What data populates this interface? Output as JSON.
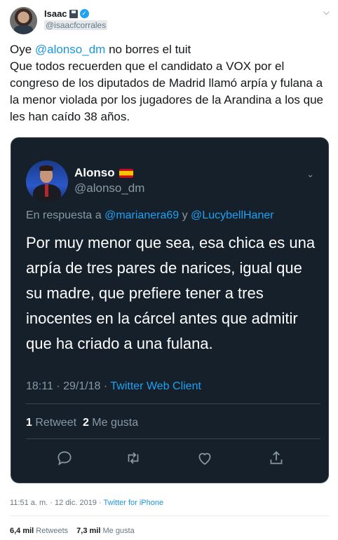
{
  "author": {
    "name": "Isaac",
    "handle": "@isaacfcorrales"
  },
  "tweet": {
    "line1_prefix": "Oye ",
    "line1_mention": "@alonso_dm",
    "line1_suffix": " no borres el tuit",
    "body": "Que todos recuerden que el candidato a VOX por el congreso de los diputados de Madrid llamó arpía y fulana a la menor violada por los jugadores de la Arandina a los que les han caído 38 años."
  },
  "quote": {
    "name": "Alonso",
    "handle": "@alonso_dm",
    "reply_prefix": "En respuesta a ",
    "reply_mention1": "@marianera69",
    "reply_and": " y ",
    "reply_mention2": "@LucybellHaner",
    "text": "Por muy menor que sea, esa chica es una arpía de tres pares de narices, igual que su madre, que prefiere tener a tres inocentes en la cárcel antes que admitir que ha criado a una fulana.",
    "time": "18:11 · 29/1/18 · ",
    "client": "Twitter Web Client",
    "retweets_count": "1",
    "retweets_label": " Retweet",
    "likes_count": "2",
    "likes_label": " Me gusta"
  },
  "meta": {
    "time": "11:51 a. m. · 12 dic. 2019 · ",
    "client": "Twitter for iPhone"
  },
  "stats": {
    "retweets_count": "6,4 mil",
    "retweets_label": " Retweets",
    "likes_count": "7,3 mil",
    "likes_label": " Me gusta"
  },
  "icons": {
    "caret": "chevron-down-icon",
    "verified": "verified-badge-icon",
    "floppy": "floppy-disk-emoji",
    "flag": "spain-flag-emoji"
  },
  "colors": {
    "link": "#1b95e0",
    "quote_bg": "#15202b"
  }
}
